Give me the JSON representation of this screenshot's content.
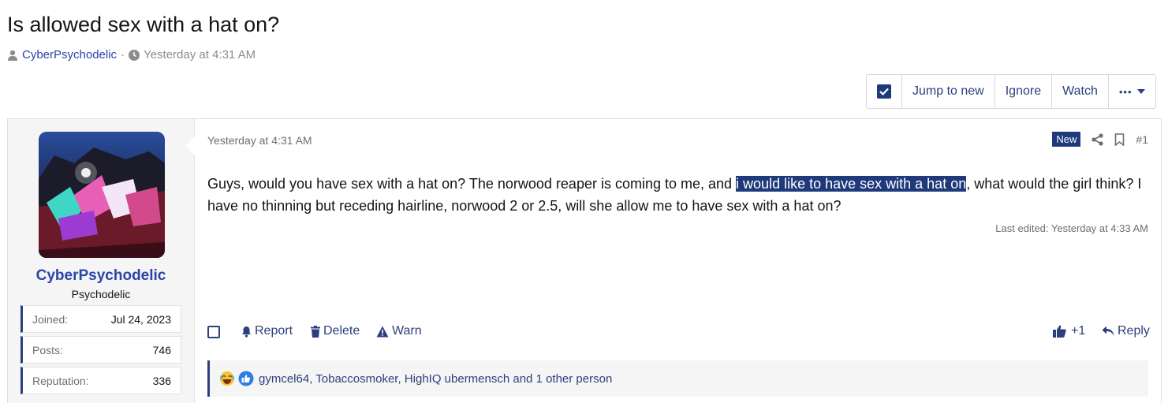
{
  "thread": {
    "title": "Is allowed sex with a hat on?",
    "author": "CyberPsychodelic",
    "separator": "·",
    "date": "Yesterday at 4:31 AM"
  },
  "toolbar": {
    "jump_label": "Jump to new",
    "ignore_label": "Ignore",
    "watch_label": "Watch",
    "more_label": "•••"
  },
  "user": {
    "name": "CyberPsychodelic",
    "title": "Psychodelic",
    "stats": [
      {
        "key": "Joined:",
        "value": "Jul 24, 2023"
      },
      {
        "key": "Posts:",
        "value": "746"
      },
      {
        "key": "Reputation:",
        "value": "336"
      }
    ]
  },
  "post": {
    "date": "Yesterday at 4:31 AM",
    "badge": "New",
    "number": "#1",
    "body_before": "Guys, would you have sex with a hat on? The norwood reaper is coming to me, and ",
    "body_highlight": "i would like to have sex with a hat on",
    "body_after": ", what would the girl think? I have no thinning but receding hairline, norwood 2 or 2.5, will she allow me to have sex with a hat on?",
    "edited": "Last edited: Yesterday at 4:33 AM"
  },
  "actions": {
    "report": "Report",
    "delete": "Delete",
    "warn": "Warn",
    "like_count": "+1",
    "reply": "Reply"
  },
  "reactions": {
    "text": "gymcel64, Tobaccosmoker, HighIQ ubermensch and 1 other person"
  },
  "colors": {
    "accent": "#1f3a7a",
    "link": "#2b44a8"
  }
}
